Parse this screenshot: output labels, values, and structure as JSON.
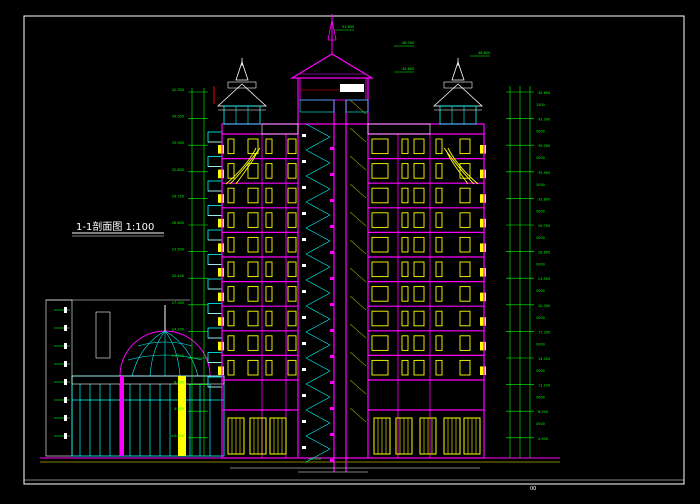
{
  "drawing": {
    "title": "1-1剖面图 1:100",
    "corner_mark": "00",
    "colors": {
      "background": "#000000",
      "frame": "#ffffff",
      "structure": "#ff00ff",
      "window": "#ffff00",
      "annotation": "#00ff00",
      "glass": "#00ffff",
      "accent": "#ff0000"
    },
    "left_elevations": [
      "42.300",
      "39.000",
      "35.900",
      "32.800",
      "29.700",
      "26.600",
      "23.500",
      "20.400",
      "17.300",
      "14.200",
      "11.100",
      "8.000",
      "4.900",
      "±0.000"
    ],
    "right_dims": [
      "1500",
      "3000",
      "3000",
      "3000",
      "3000",
      "3000",
      "3000",
      "3000",
      "3000",
      "3000",
      "3000",
      "3000",
      "4500"
    ],
    "right_elevations": [
      "45.600",
      "42.300",
      "39.000",
      "35.900",
      "32.800",
      "29.700",
      "26.600",
      "23.500",
      "20.400",
      "17.300",
      "14.200",
      "11.100",
      "8.000",
      "4.900"
    ],
    "top_labels": [
      "51.600",
      "48.300",
      "46.800",
      "45.600"
    ],
    "bottom_label": "±0.000"
  }
}
